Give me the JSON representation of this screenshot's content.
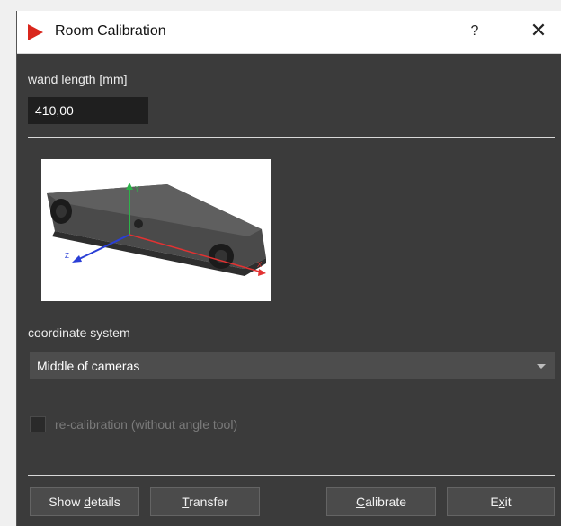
{
  "window": {
    "title": "Room Calibration",
    "help_label": "?",
    "close_label": "✕"
  },
  "wand": {
    "label": "wand length [mm]",
    "value": "410,00"
  },
  "coordinate": {
    "label": "coordinate system",
    "selected": "Middle of cameras"
  },
  "recalibration": {
    "label": "re-calibration (without angle tool)",
    "checked": false,
    "enabled": false
  },
  "image": {
    "axis_y": "Y",
    "axis_x": "X",
    "axis_z": "Z"
  },
  "buttons": {
    "show_details": {
      "pre": "Show ",
      "acc": "d",
      "post": "etails"
    },
    "transfer": {
      "pre": "",
      "acc": "T",
      "post": "ransfer"
    },
    "calibrate": {
      "pre": "",
      "acc": "C",
      "post": "alibrate"
    },
    "exit": {
      "pre": "E",
      "acc": "x",
      "post": "it"
    }
  },
  "colors": {
    "accent_red": "#d9261c",
    "background": "#3b3b3b"
  }
}
